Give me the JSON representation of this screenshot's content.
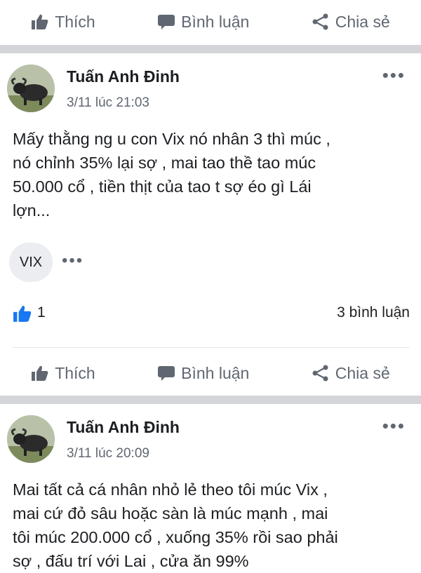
{
  "actions": {
    "like": "Thích",
    "comment": "Bình luận",
    "share": "Chia sẻ"
  },
  "posts": [
    {
      "author": "Tuấn Anh Đinh",
      "time": "3/11 lúc 21:03",
      "text": "Mấy thằng ng u con Vix nó nhân 3 thì múc ,\nnó chỉnh 35% lại sợ , mai tao thề tao múc\n50.000 cổ , tiền thịt của tao t sợ éo gì Lái\nlợn...",
      "tag": "VIX",
      "likes": "1",
      "comments": "3 bình luận"
    },
    {
      "author": "Tuấn Anh Đinh",
      "time": "3/11 lúc 20:09",
      "text": "Mai tất cả cá nhân nhỏ lẻ theo tôi múc Vix ,\nmai cứ đỏ sâu hoặc sàn là múc mạnh , mai\ntôi múc 200.000 cổ , xuống 35% rồi sao phải\nsợ , đấu trí với Lai , cửa ăn 99%"
    }
  ],
  "more_symbol": "•••",
  "colors": {
    "like_blue": "#1877f2",
    "secondary": "#606770",
    "separator": "#d4d5d9"
  }
}
